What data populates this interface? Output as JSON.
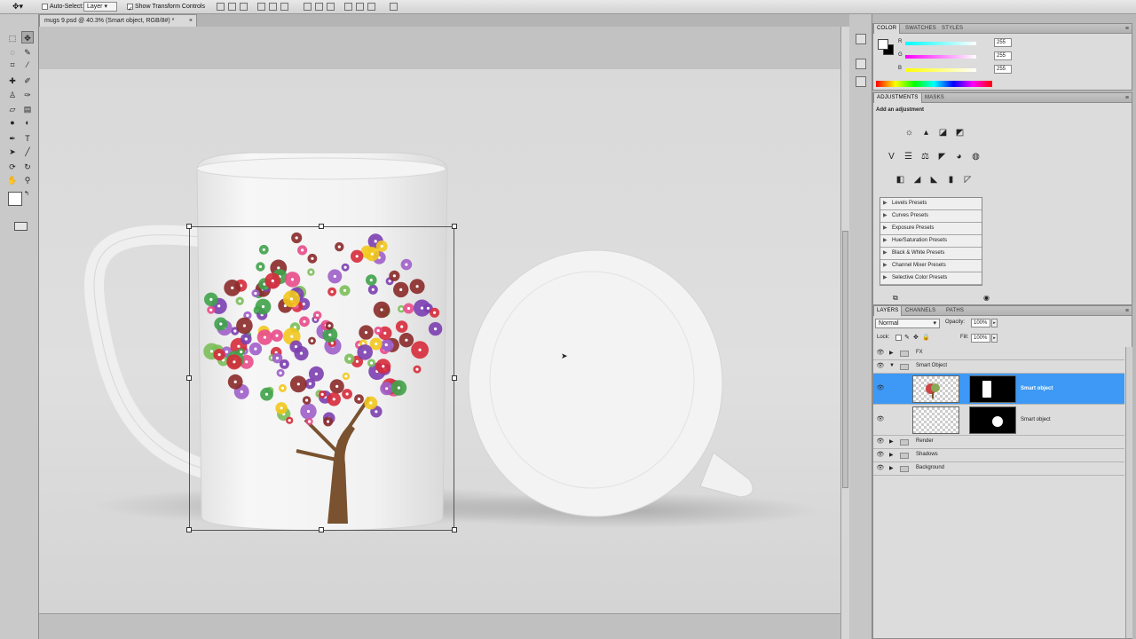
{
  "options_bar": {
    "auto_select_label": "Auto-Select:",
    "auto_select_value": "Layer",
    "show_transform_label": "Show Transform Controls"
  },
  "document": {
    "tab_title": "mugs 9.psd @ 40.3% (Smart object, RGB/8#) *",
    "tab_close": "×"
  },
  "color_panel": {
    "tabs": [
      "COLOR",
      "SWATCHES",
      "STYLES"
    ],
    "r_label": "R",
    "g_label": "G",
    "b_label": "B",
    "r_value": "255",
    "g_value": "255",
    "b_value": "255"
  },
  "adjustments_panel": {
    "tabs": [
      "ADJUSTMENTS",
      "MASKS"
    ],
    "heading": "Add an adjustment",
    "presets": [
      "Levels Presets",
      "Curves Presets",
      "Exposure Presets",
      "Hue/Saturation Presets",
      "Black & White Presets",
      "Channel Mixer Presets",
      "Selective Color Presets"
    ]
  },
  "layers_panel": {
    "tabs": [
      "LAYERS",
      "CHANNELS",
      "PATHS"
    ],
    "blend_mode": "Normal",
    "opacity_label": "Opacity:",
    "opacity_value": "100%",
    "lock_label": "Lock:",
    "fill_label": "Fill:",
    "fill_value": "100%",
    "groups": {
      "fx": "FX",
      "smart_object_group": "Smart Object",
      "render": "Render",
      "shadows": "Shadows",
      "background": "Background"
    },
    "layer_1_name": "Smart object",
    "layer_2_name": "Smart object"
  },
  "colors": {
    "selection": "#3d99f5",
    "canvas": "#dcdcdc"
  }
}
